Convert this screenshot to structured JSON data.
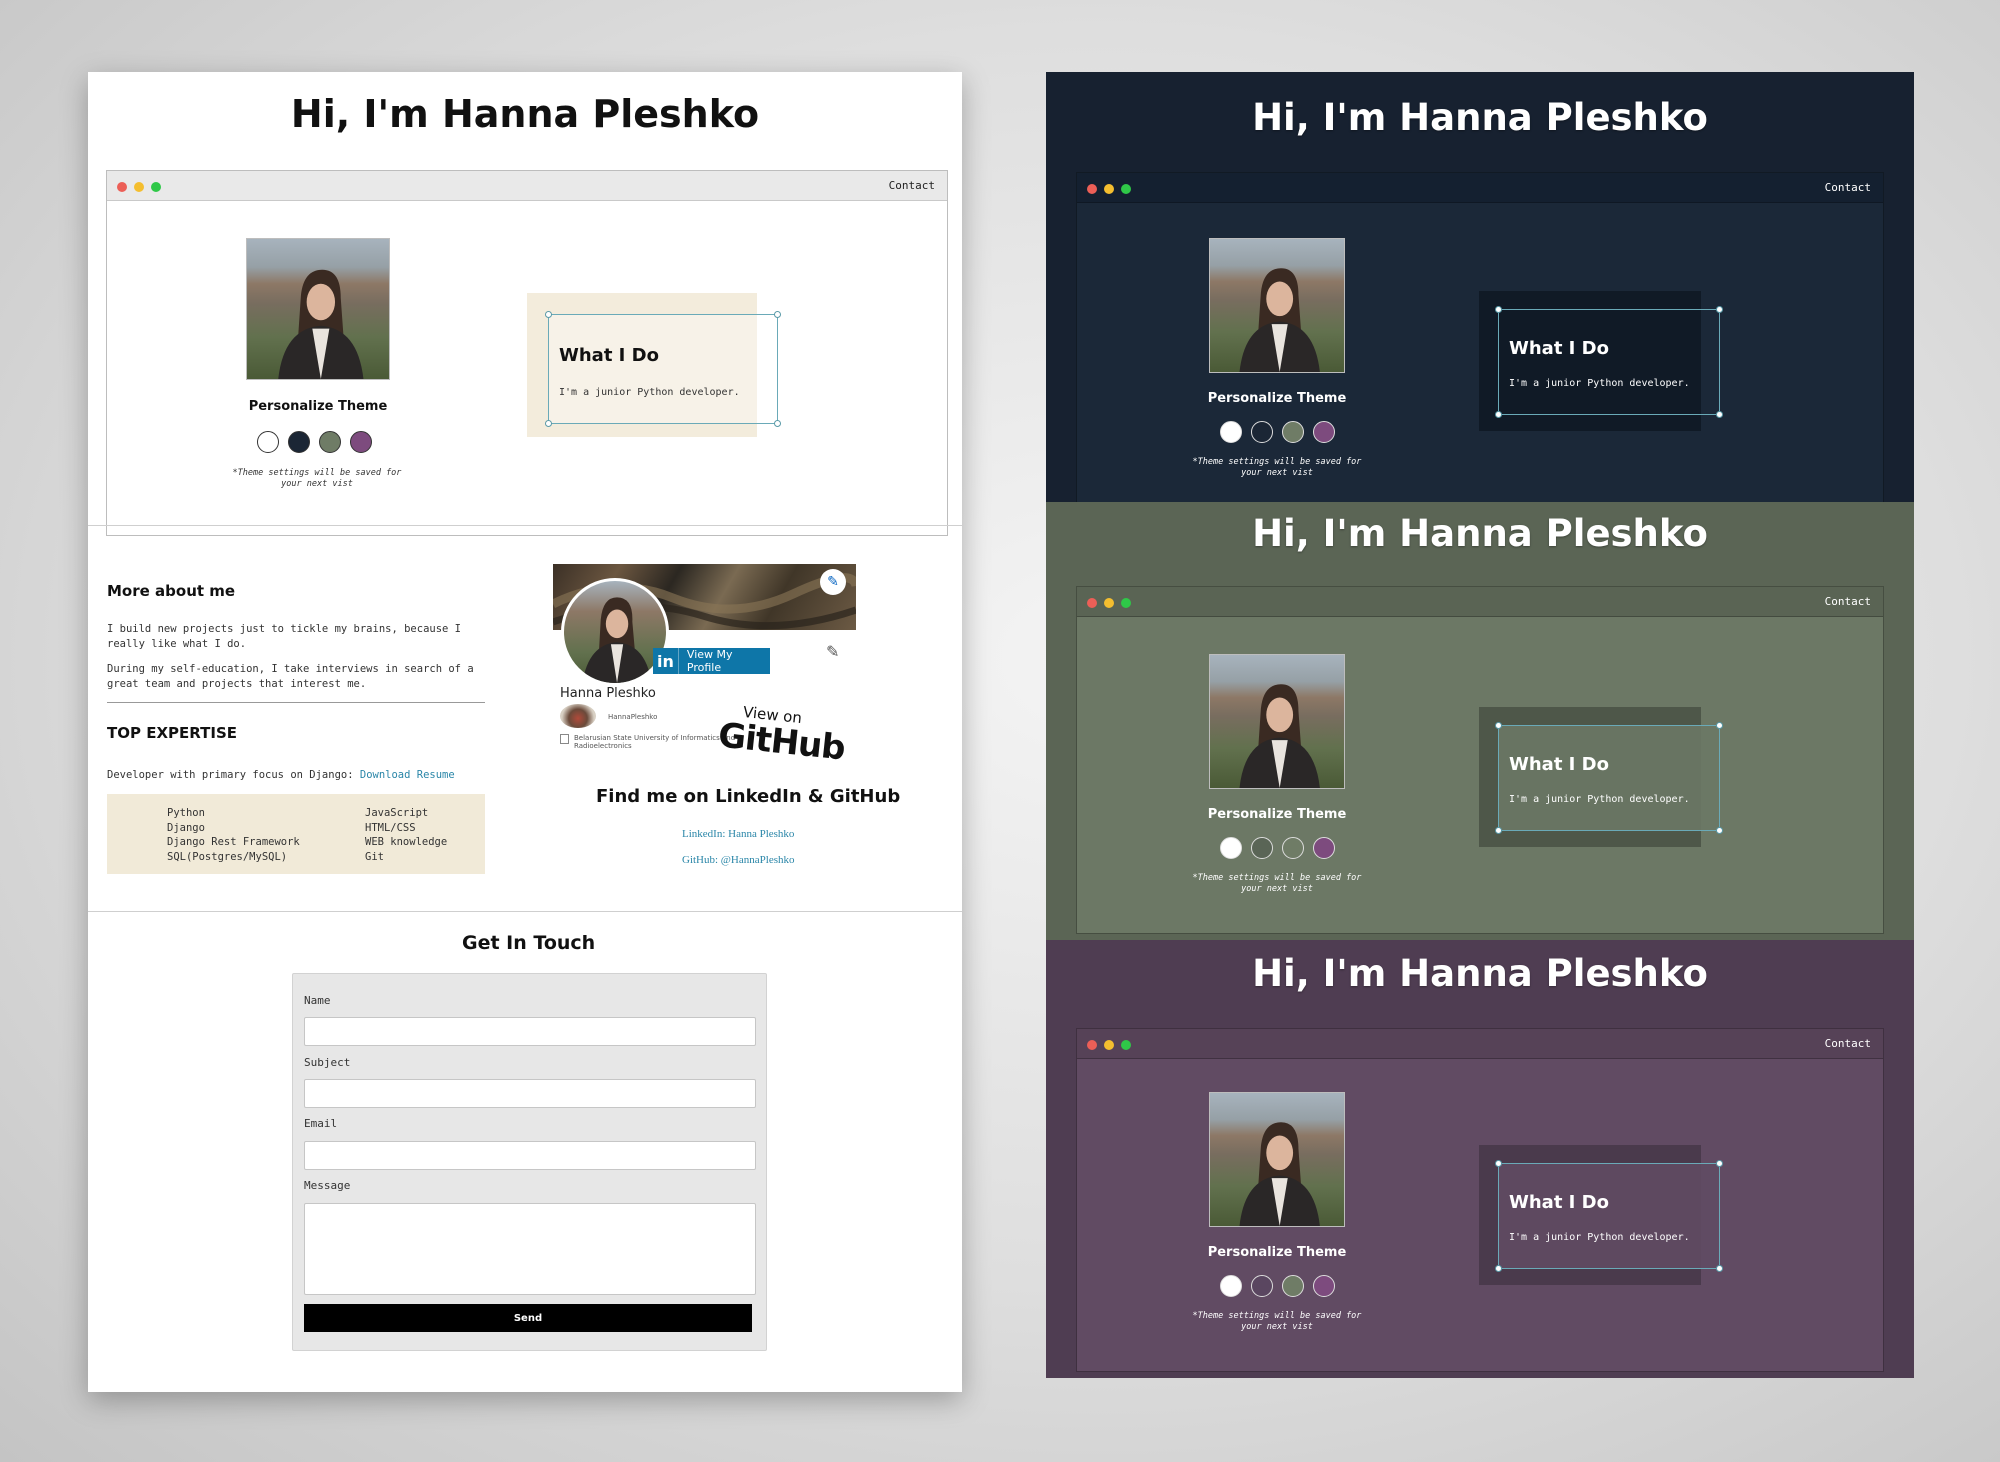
{
  "page_title": "Hi, I'm Hanna Pleshko",
  "nav": {
    "contact": "Contact"
  },
  "theme_picker": {
    "title": "Personalize Theme",
    "note": "*Theme settings will be saved for your next vist",
    "swatches": [
      {
        "name": "light",
        "color": "#ffffff"
      },
      {
        "name": "dark",
        "color": "#1b2635"
      },
      {
        "name": "sage",
        "color": "#6f7c66"
      },
      {
        "name": "purple",
        "color": "#7d4b7e"
      }
    ]
  },
  "what_i_do": {
    "title": "What I Do",
    "text": "I'm a junior Python developer."
  },
  "about": {
    "title": "More about me",
    "p1": "I build new projects just to tickle my brains, because I really like what I do.",
    "p2": "During my self-education, I take interviews in search of a great team and projects that interest me."
  },
  "expertise": {
    "title": "TOP EXPERTISE",
    "intro": "Developer with primary focus on Django:",
    "resume_link": "Download Resume",
    "col1": [
      "Python",
      "Django",
      "Django Rest Framework",
      "SQL(Postgres/MySQL)"
    ],
    "col2": [
      "JavaScript",
      "HTML/CSS",
      "WEB knowledge",
      "Git"
    ]
  },
  "linkedin_badge": {
    "button": "View My Profile",
    "button_icon": "in",
    "name": "Hanna Pleshko",
    "handle": "HannaPleshko",
    "school": "Belarusian State University of Informatics and Radioelectronics"
  },
  "github_badge": {
    "view_on": "View on",
    "brand": "GitHub"
  },
  "find_me": {
    "title": "Find me on LinkedIn & GitHub",
    "linkedin": "LinkedIn: Hanna Pleshko",
    "github": "GitHub: @HannaPleshko"
  },
  "contact_form": {
    "title": "Get In Touch",
    "name_label": "Name",
    "subject_label": "Subject",
    "email_label": "Email",
    "message_label": "Message",
    "send": "Send"
  },
  "themes": {
    "dark": {
      "bg": "#172130",
      "inner": "#1b2838",
      "bar": "#142030",
      "widget_bg": "#101a26",
      "swatches": [
        "#ffffff",
        "#1b2635",
        "#6f7c66",
        "#7d4b7e"
      ]
    },
    "sage": {
      "bg": "#5b6555",
      "inner": "#6c7865",
      "bar": "#5a6454",
      "widget_bg": "#4e5749",
      "swatches": [
        "#ffffff",
        "#5a6556",
        "#6f7c66",
        "#7d4b7e"
      ]
    },
    "purple": {
      "bg": "#4f3d52",
      "inner": "#614b63",
      "bar": "#564257",
      "widget_bg": "#4a3a4c",
      "swatches": [
        "#ffffff",
        "#5a4660",
        "#6f7c66",
        "#7d4b7e"
      ]
    }
  }
}
